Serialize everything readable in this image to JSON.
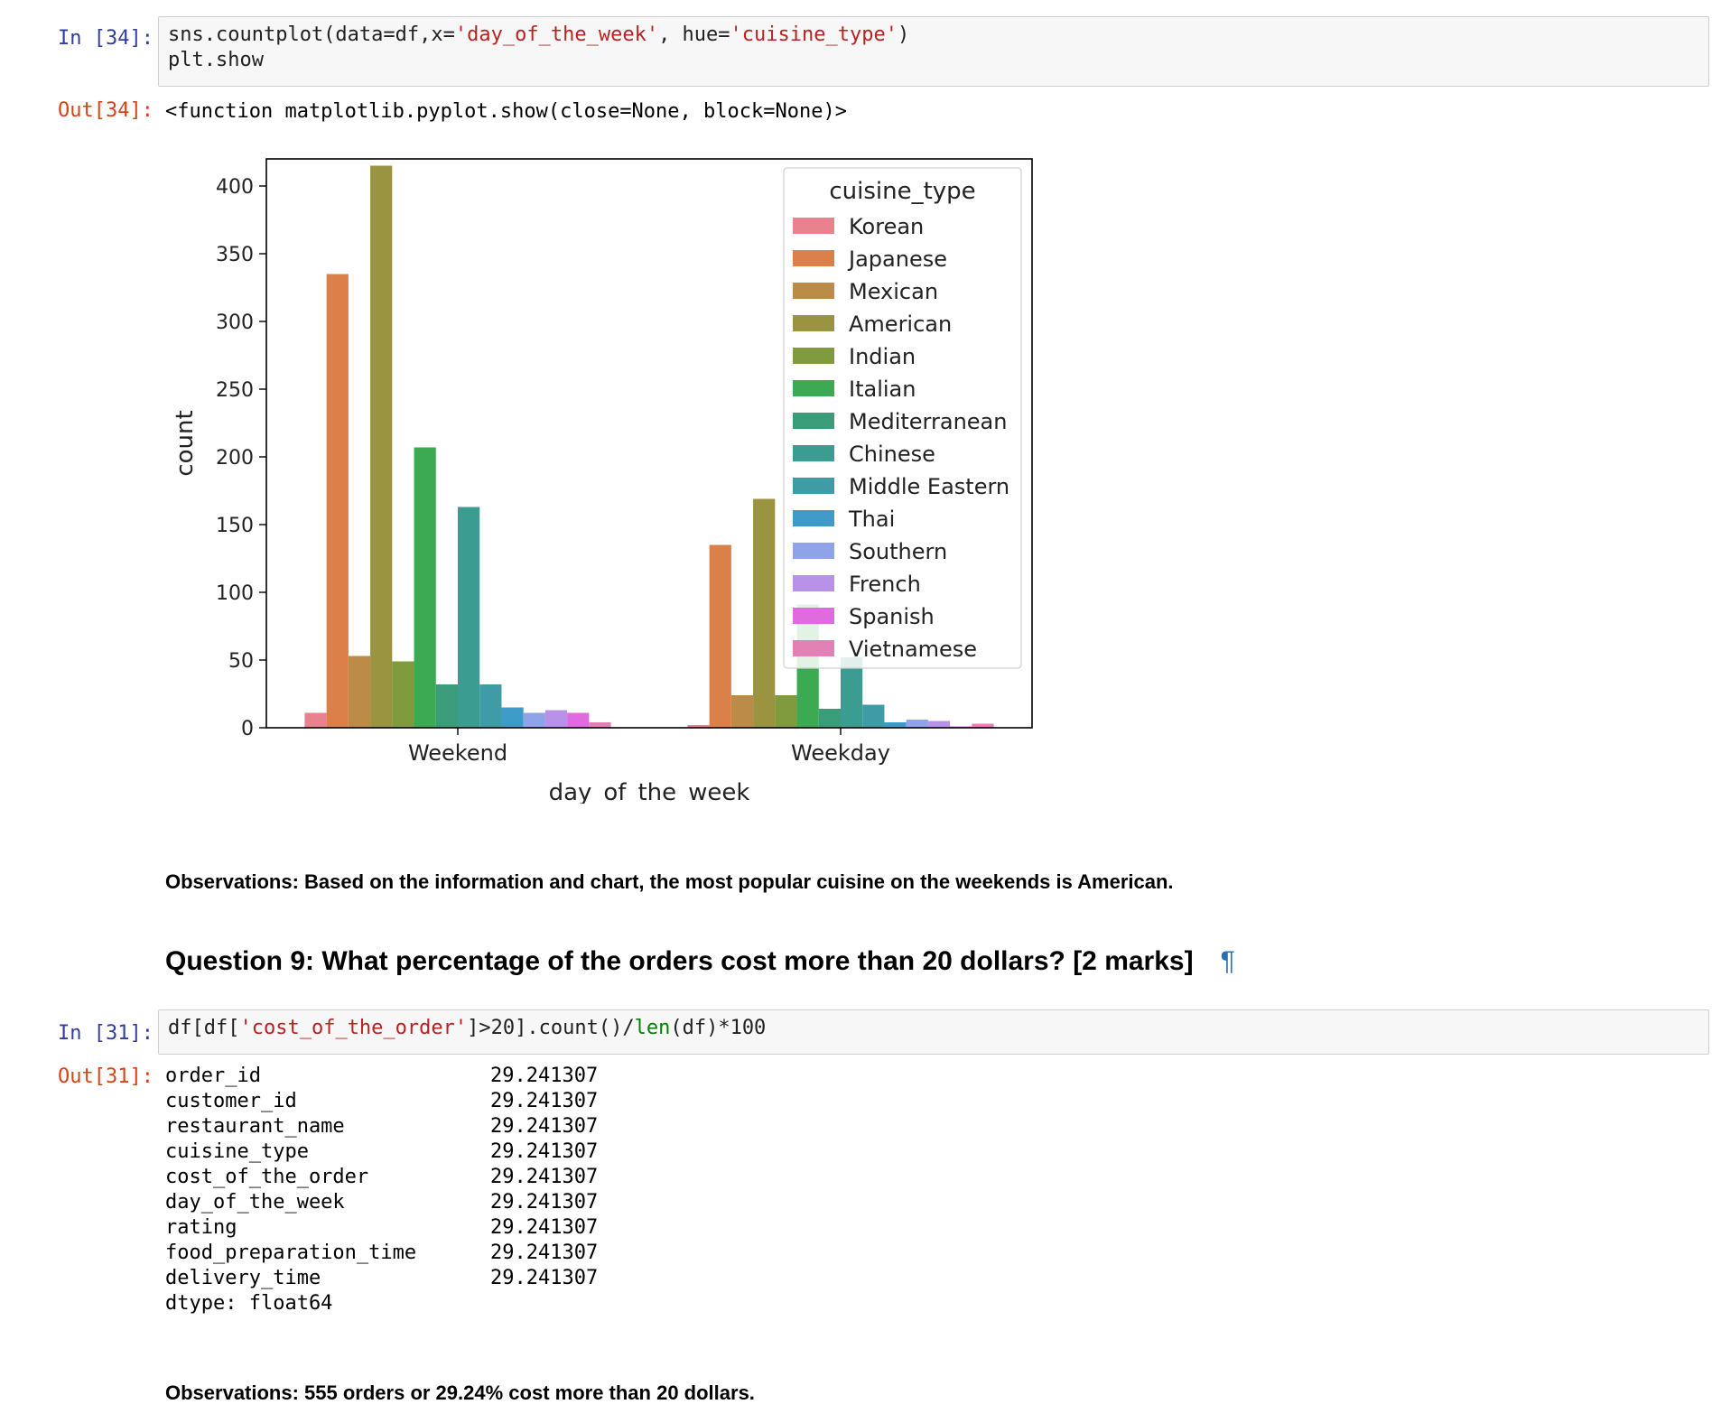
{
  "cells": {
    "in34": {
      "prompt": "In [34]:",
      "code_parts": [
        "sns.countplot(data=df,x=",
        "'day_of_the_week'",
        ", hue=",
        "'cuisine_type'",
        ")",
        "plt.show"
      ]
    },
    "out34": {
      "prompt": "Out[34]:",
      "text": "<function matplotlib.pyplot.show(close=None, block=None)>"
    },
    "obs1": "Observations: Based on the information and chart, the most popular cuisine on the weekends is American.",
    "question": {
      "text": "Question 9: What percentage of the orders cost more than 20 dollars? [2 marks]",
      "pilcrow": "¶"
    },
    "in31": {
      "prompt": "In [31]:",
      "code_parts": [
        "df[df[",
        "'cost_of_the_order'",
        "]>20].count()/",
        "len",
        "(df)*100"
      ]
    },
    "out31": {
      "prompt": "Out[31]:",
      "rows": [
        {
          "key": "order_id",
          "value": "29.241307"
        },
        {
          "key": "customer_id",
          "value": "29.241307"
        },
        {
          "key": "restaurant_name",
          "value": "29.241307"
        },
        {
          "key": "cuisine_type",
          "value": "29.241307"
        },
        {
          "key": "cost_of_the_order",
          "value": "29.241307"
        },
        {
          "key": "day_of_the_week",
          "value": "29.241307"
        },
        {
          "key": "rating",
          "value": "29.241307"
        },
        {
          "key": "food_preparation_time",
          "value": "29.241307"
        },
        {
          "key": "delivery_time",
          "value": "29.241307"
        }
      ],
      "dtype": "dtype: float64"
    },
    "obs2": "Observations: 555 orders or 29.24% cost more than 20 dollars."
  },
  "chart_data": {
    "type": "bar",
    "categories": [
      "Weekend",
      "Weekday"
    ],
    "xlabel": "day_of_the_week",
    "ylabel": "count",
    "ylim": [
      0,
      420
    ],
    "yticks": [
      0,
      50,
      100,
      150,
      200,
      250,
      300,
      350,
      400
    ],
    "legend_title": "cuisine_type",
    "legend_position": "top-right",
    "grid": false,
    "series": [
      {
        "name": "Korean",
        "color": "#e8828f",
        "values": [
          11,
          2
        ]
      },
      {
        "name": "Japanese",
        "color": "#dc8049",
        "values": [
          335,
          135
        ]
      },
      {
        "name": "Mexican",
        "color": "#bc8b48",
        "values": [
          53,
          24
        ]
      },
      {
        "name": "American",
        "color": "#9a9340",
        "values": [
          415,
          169
        ]
      },
      {
        "name": "Indian",
        "color": "#7f9b3e",
        "values": [
          49,
          24
        ]
      },
      {
        "name": "Italian",
        "color": "#3caa52",
        "values": [
          207,
          91
        ]
      },
      {
        "name": "Mediterranean",
        "color": "#3a9c78",
        "values": [
          32,
          14
        ]
      },
      {
        "name": "Chinese",
        "color": "#3b9c91",
        "values": [
          163,
          52
        ]
      },
      {
        "name": "Middle Eastern",
        "color": "#3f9ba6",
        "values": [
          32,
          17
        ]
      },
      {
        "name": "Thai",
        "color": "#3e9bc8",
        "values": [
          15,
          4
        ]
      },
      {
        "name": "Southern",
        "color": "#8fa4e8",
        "values": [
          11,
          6
        ]
      },
      {
        "name": "French",
        "color": "#b792e8",
        "values": [
          13,
          5
        ]
      },
      {
        "name": "Spanish",
        "color": "#e06be0",
        "values": [
          11,
          1
        ]
      },
      {
        "name": "Vietnamese",
        "color": "#e380b6",
        "values": [
          4,
          3
        ]
      }
    ]
  }
}
